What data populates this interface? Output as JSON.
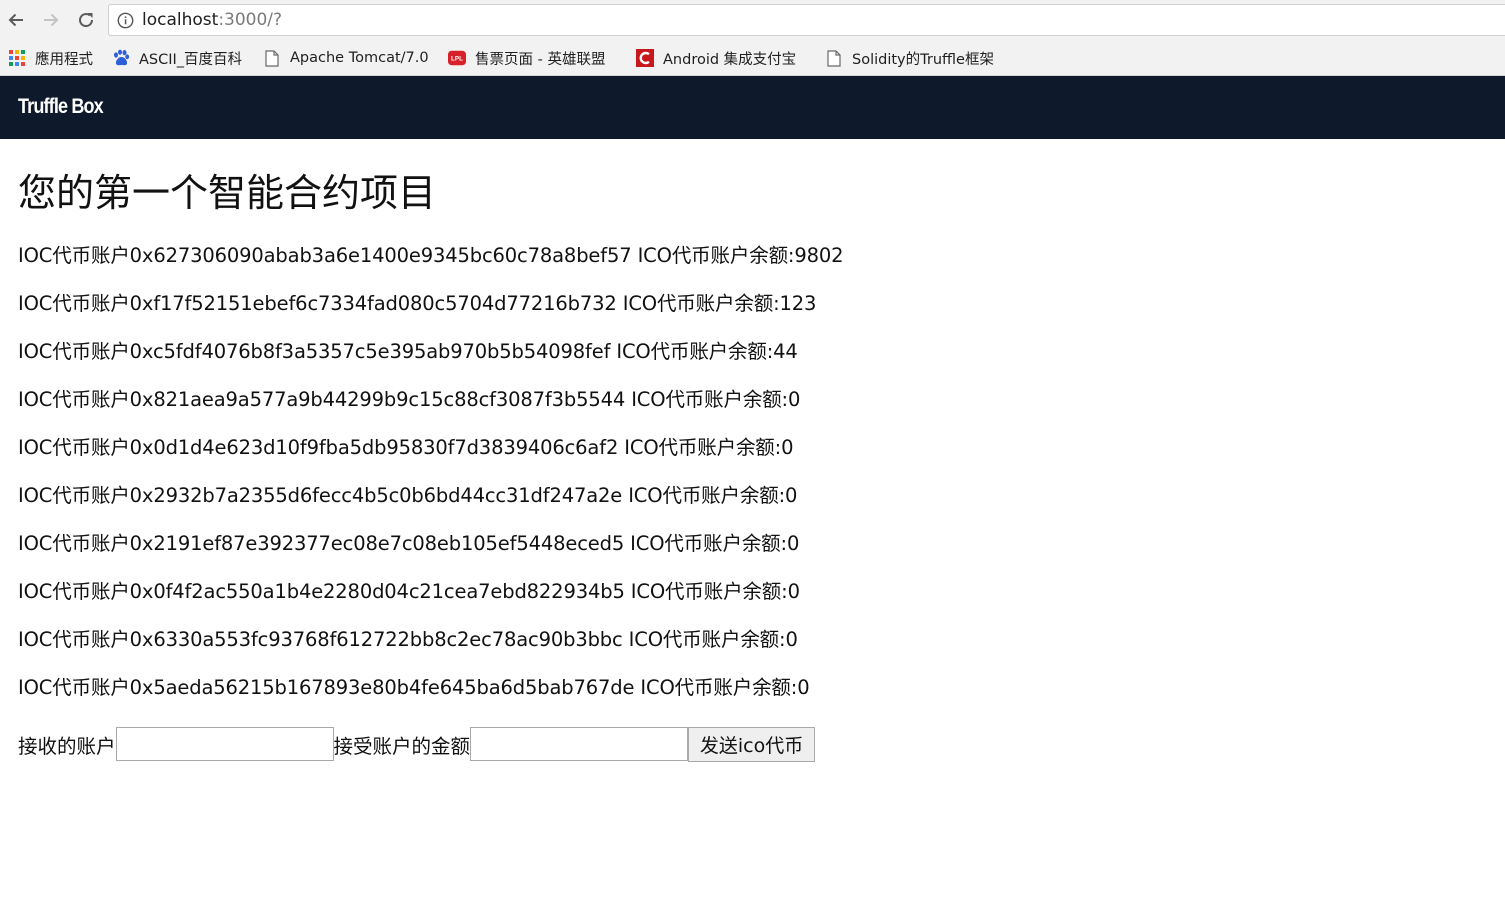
{
  "browser": {
    "url_host": "localhost",
    "url_rest": ":3000/?",
    "bookmarks": [
      {
        "label": "應用程式",
        "icon": "apps-grid-icon"
      },
      {
        "label": "ASCII_百度百科",
        "icon": "baidu-paw-icon"
      },
      {
        "label": "Apache Tomcat/7.0",
        "icon": "page-icon"
      },
      {
        "label": "售票页面 - 英雄联盟",
        "icon": "lpl-icon"
      },
      {
        "label": "Android 集成支付宝",
        "icon": "csdn-c-icon"
      },
      {
        "label": "Solidity的Truffle框架",
        "icon": "page-icon"
      }
    ]
  },
  "app": {
    "brand": "Truffle Box",
    "title": "您的第一个智能合约项目"
  },
  "accounts": [
    {
      "prefix": "IOC代币账户",
      "address": "0x627306090abab3a6e1400e9345bc60c78a8bef57",
      "balance_label": "ICO代币账户余额:",
      "balance": "9802"
    },
    {
      "prefix": "IOC代币账户",
      "address": "0xf17f52151ebef6c7334fad080c5704d77216b732",
      "balance_label": "ICO代币账户余额:",
      "balance": "123"
    },
    {
      "prefix": "IOC代币账户",
      "address": "0xc5fdf4076b8f3a5357c5e395ab970b5b54098fef",
      "balance_label": "ICO代币账户余额:",
      "balance": "44"
    },
    {
      "prefix": "IOC代币账户",
      "address": "0x821aea9a577a9b44299b9c15c88cf3087f3b5544",
      "balance_label": "ICO代币账户余额:",
      "balance": "0"
    },
    {
      "prefix": "IOC代币账户",
      "address": "0x0d1d4e623d10f9fba5db95830f7d3839406c6af2",
      "balance_label": "ICO代币账户余额:",
      "balance": "0"
    },
    {
      "prefix": "IOC代币账户",
      "address": "0x2932b7a2355d6fecc4b5c0b6bd44cc31df247a2e",
      "balance_label": "ICO代币账户余额:",
      "balance": "0"
    },
    {
      "prefix": "IOC代币账户",
      "address": "0x2191ef87e392377ec08e7c08eb105ef5448eced5",
      "balance_label": "ICO代币账户余额:",
      "balance": "0"
    },
    {
      "prefix": "IOC代币账户",
      "address": "0x0f4f2ac550a1b4e2280d04c21cea7ebd822934b5",
      "balance_label": "ICO代币账户余额:",
      "balance": "0"
    },
    {
      "prefix": "IOC代币账户",
      "address": "0x6330a553fc93768f612722bb8c2ec78ac90b3bbc",
      "balance_label": "ICO代币账户余额:",
      "balance": "0"
    },
    {
      "prefix": "IOC代币账户",
      "address": "0x5aeda56215b167893e80b4fe645ba6d5bab767de",
      "balance_label": "ICO代币账户余额:",
      "balance": "0"
    }
  ],
  "form": {
    "recipient_label": "接收的账户",
    "recipient_value": "",
    "amount_label": "接受账户的金额",
    "amount_value": "",
    "send_button": "发送ico代币"
  },
  "colors": {
    "navbar": "#0e1a2b",
    "chrome": "#f2f2f2"
  }
}
